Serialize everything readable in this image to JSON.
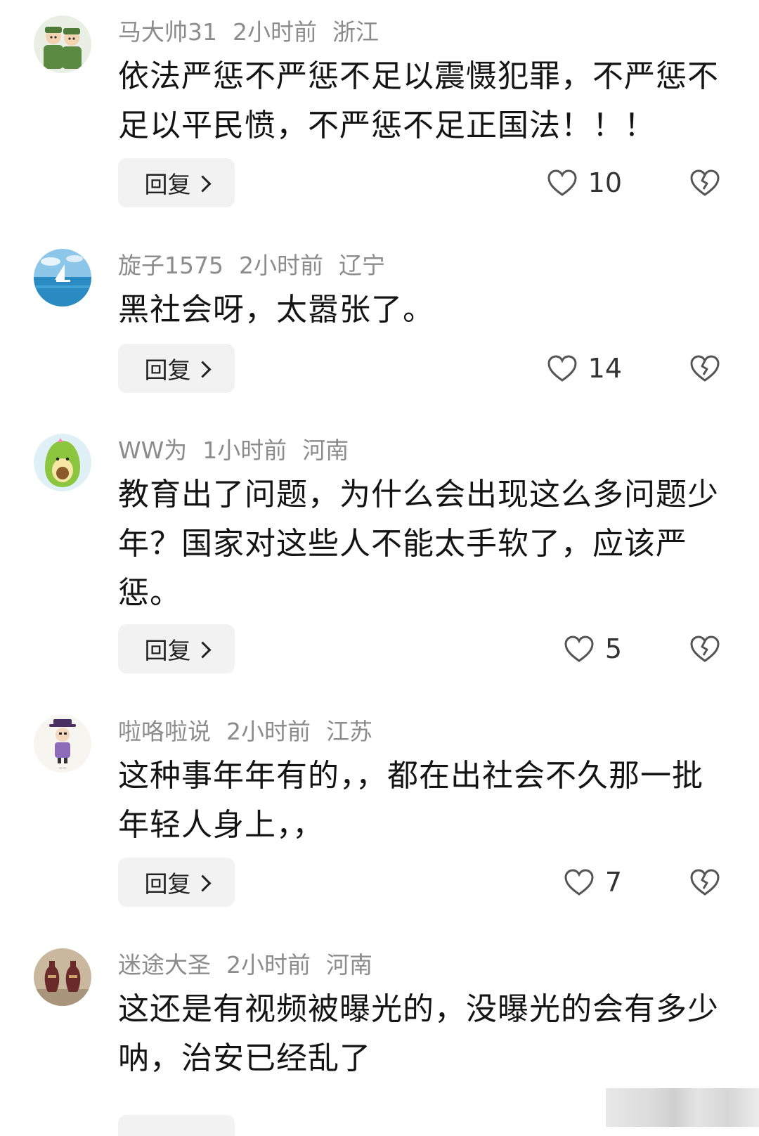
{
  "comments": [
    {
      "username": "马大帅31",
      "time": "2小时前",
      "location": "浙江",
      "text": "依法严惩不严惩不足以震慑犯罪，不严惩不足以平民愤，不严惩不足正国法！！！",
      "reply_label": "回复",
      "likes": "10",
      "avatar_icon": "soldiers-avatar-icon"
    },
    {
      "username": "旋子1575",
      "time": "2小时前",
      "location": "辽宁",
      "text": "黑社会呀，太嚣张了。",
      "reply_label": "回复",
      "likes": "14",
      "avatar_icon": "sea-sailboat-avatar-icon"
    },
    {
      "username": "WW为",
      "time": "1小时前",
      "location": "河南",
      "text": "教育出了问题，为什么会出现这么多问题少年？国家对这些人不能太手软了，应该严惩。",
      "reply_label": "回复",
      "likes": "5",
      "avatar_icon": "avocado-avatar-icon"
    },
    {
      "username": "啦咯啦说",
      "time": "2小时前",
      "location": "江苏",
      "text": "这种事年年有的，，都在出社会不久那一批年轻人身上，，",
      "reply_label": "回复",
      "likes": "7",
      "avatar_icon": "cartoon-person-avatar-icon"
    },
    {
      "username": "迷途大圣",
      "time": "2小时前",
      "location": "河南",
      "text": "这还是有视频被曝光的，没曝光的会有多少呐，治安已经乱了",
      "avatar_icon": "vases-avatar-icon"
    }
  ],
  "colors": {
    "meta_text": "#8c8c8c",
    "body_text": "#141414",
    "reply_bg": "#f2f2f2",
    "icon_stroke": "#555555"
  }
}
